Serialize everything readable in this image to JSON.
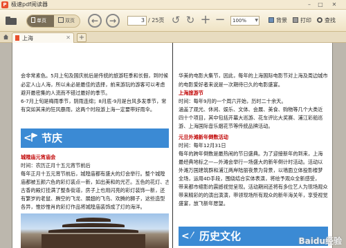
{
  "app": {
    "title": "极速pdf阅读器"
  },
  "toolbar": {
    "single_page_label": "单页",
    "double_page_label": "双页",
    "page_current": "3",
    "page_total": "/ 25页",
    "zoom_value": "100%",
    "background_label": "背景",
    "print_label": "打印",
    "search_label": "查找"
  },
  "tabs": [
    {
      "label": "上海"
    }
  ],
  "document": {
    "left": {
      "intro_lines": [
        "会非常素色。5月上旬及国庆前后是传统的旅游旺季和长假，到时候",
        "必定人山人海，所以未必是最佳的选择，前来游玩的游客可以考虑",
        "避开最密集的人流而不错过最好的季节。",
        "6-7月上旬是梅雨季节，阴雨连绵；8月底-9月是台风多发季节，常",
        "有突如其来的狂风暴雨，这两个时段游上海一定要带好雨伞。"
      ],
      "section_title": "节庆",
      "festival_title": "城隍庙元宵庙会",
      "festival_time": "时间：农历正月十五元宵节前后",
      "festival_lines": [
        "每年正月十五元宵节前后，城隍庙都有盛大的灯会举行。整个城隍",
        "庙都被五颜六色的彩灯装点一新，如出美和的光芒。五色的花灯、古色",
        "古香的殿灯挂满了整条街道，房子上也用闪亮的彩灯装饰一新，还",
        "有繁岁的老鼠、腾空的飞龙、展翅的飞鸟、欢腾的狮子，这些造型",
        "各异，惟妙惟肖的彩灯作品将城隍庙装饰成了灯的海洋。"
      ]
    },
    "right": {
      "intro_lines": [
        "华美的电影大集节，因此，每年的上海国际电影节对上海及周边城市",
        "的电影爱好者来说是一次期待已久的电影盛宴。"
      ],
      "tourism_title": "上海旅游节",
      "tourism_time": "时间：每年9月的一个周六开始，历时二十余天。",
      "tourism_lines": [
        "涵盖了观光、休闲、娱乐、文体、会展、美食、购物等几个大类近",
        "四十个项目，其中包括开幕大巡游、花车评比大奖赛、浦江彩船巡",
        "游、上海国际音乐烟花节等传统品牌活动。"
      ],
      "fireworks_title": "元旦外滩新年倒数活动",
      "fireworks_time": "时间：每年12月31日",
      "fireworks_lines": [
        "每年的跨年倒数是最热闹的节日盛典。为了迎接新年的到来，上海",
        "最经典地标之一—外滩会举行一场盛大的新年倒计时活动。活动以",
        "外滩万国建筑群和浦江两岸陆丽夜景为背景，以墙面立体投影楼梦",
        "全场，运用4D手段，围绕结合实体表演，将绘予观众全新感受，",
        "带来都市缩影的震撼视觉呈现。活动期间还将有多位艺人为现场观众",
        "带来精彩的的演出演演，带领现场所有观众的新年海关年，享受视觉",
        "盛宴，放飞新年愿望。"
      ],
      "section_title": "历史文化"
    }
  },
  "watermark": "Baidu经验",
  "colors": {
    "banner_blue": "#3b8ad4",
    "heading_red": "#c00000",
    "toolbar_bg": "#f4ead2"
  }
}
